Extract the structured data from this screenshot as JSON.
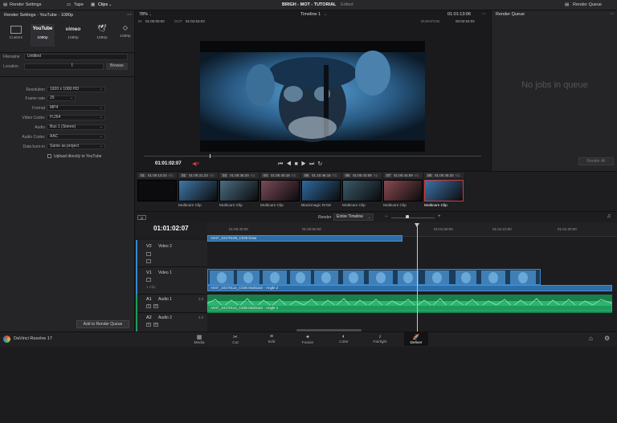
{
  "topbar": {
    "render_settings": "Render Settings",
    "tape": "Tape",
    "clips": "Clips",
    "project_title": "BRIGH - MOT - TUTORIAL",
    "edited": "Edited",
    "render_queue_btn": "Render Queue"
  },
  "left_panel": {
    "header": "Render Settings - YouTube - 1080p",
    "presets": [
      {
        "name": "Custom",
        "icon": "film-icon"
      },
      {
        "name": "1080p",
        "icon": "youtube-logo"
      },
      {
        "name": "1080p",
        "icon": "vimeo-logo"
      },
      {
        "name": "1080p",
        "icon": "twitter-icon"
      },
      {
        "name": "1080p",
        "icon": "dropbox-icon"
      }
    ],
    "youtube_logo": "YouTube",
    "vimeo_logo": "vimeo",
    "filename_label": "Filename",
    "filename_value": "Untitled",
    "location_label": "Location",
    "location_value": "",
    "browse_button": "Browse",
    "settings": [
      {
        "label": "Resolution",
        "value": "1920 x 1080 HD"
      },
      {
        "label": "Frame rate",
        "value": "25"
      },
      {
        "label": "Format",
        "value": "MP4"
      },
      {
        "label": "Video Codec",
        "value": "H.264"
      },
      {
        "label": "Audio",
        "value": "Bus 1 (Stereo)"
      },
      {
        "label": "Audio Codec",
        "value": "AAC"
      },
      {
        "label": "Data burn-in",
        "value": "Same as project"
      }
    ],
    "upload_label": "Upload directly to YouTube",
    "add_to_queue": "Add to Render Queue"
  },
  "viewer": {
    "zoom": "78%",
    "timeline_name": "Timeline 1",
    "timecode": "01:01:13:06",
    "in_label": "IN",
    "in_value": "01:00:00:00",
    "out_label": "OUT",
    "out_value": "01:02:53:03",
    "duration_label": "DURATION",
    "duration_value": "00:02:53:02",
    "current_tc": "01:01:02:07"
  },
  "render_queue": {
    "title": "Render Queue",
    "empty": "No jobs in queue",
    "render_all": "Render All"
  },
  "clips": [
    {
      "num": "01",
      "tc": "01:00:10:24",
      "track": "V1",
      "name": "",
      "color": "#0d0d0f"
    },
    {
      "num": "02",
      "tc": "01:00:31:23",
      "track": "V1",
      "name": "Multicam Clip",
      "color": "#3f78a8"
    },
    {
      "num": "03",
      "tc": "01:00:35:20",
      "track": "V1",
      "name": "Multicam Clip",
      "color": "#4a6d82"
    },
    {
      "num": "04",
      "tc": "01:00:40:18",
      "track": "V1",
      "name": "Multicam Clip",
      "color": "#7a4a58"
    },
    {
      "num": "05",
      "tc": "01:10:46:15",
      "track": "V1",
      "name": "Blackmagic RAW",
      "color": "#2e6aa0"
    },
    {
      "num": "06",
      "tc": "01:00:43:08",
      "track": "V1",
      "name": "Multicam Clip",
      "color": "#3a5a6a"
    },
    {
      "num": "07",
      "tc": "01:00:44:09",
      "track": "V1",
      "name": "Multicam Clip",
      "color": "#8a4a52"
    },
    {
      "num": "08",
      "tc": "01:00:45:20",
      "track": "V1",
      "name": "Multicam Clip",
      "color": "#3b73a8"
    }
  ],
  "timeline": {
    "timecode": "01:01:02:07",
    "render_label": "Render",
    "render_value": "Entire Timeline",
    "ruler": [
      "01:00:40:00",
      "01:00:50:00",
      "01:01:00:00",
      "01:01:10:00",
      "01:01:20:00"
    ],
    "tracks": [
      {
        "id": "V2",
        "name": "Video 2",
        "clip": "A047_10170109_C036 braw",
        "info": ""
      },
      {
        "id": "V1",
        "name": "Video 1",
        "clip": "A047_10170114_C036 Multicam - Angle 2",
        "info": "1 Clip"
      },
      {
        "id": "A1",
        "name": "Audio 1",
        "clip": "A047_10170114_C036 Multicam - Angle 1",
        "info": "2.0"
      },
      {
        "id": "A2",
        "name": "Audio 2",
        "clip": "",
        "info": "2.0"
      }
    ]
  },
  "bottombar": {
    "app_name": "DaVinci Resolve 17",
    "pages": [
      "Media",
      "Cut",
      "Edit",
      "Fusion",
      "Color",
      "Fairlight",
      "Deliver"
    ],
    "page_icons": [
      "media-icon",
      "cut-icon",
      "edit-icon",
      "fusion-icon",
      "color-icon",
      "fairlight-icon",
      "deliver-icon"
    ],
    "active_page": "Deliver"
  },
  "colors": {
    "accent": "#3a87d0",
    "audio_green": "#1f9a5a",
    "playhead": "#c9c9c9",
    "red_marker": "#d23a3a"
  }
}
